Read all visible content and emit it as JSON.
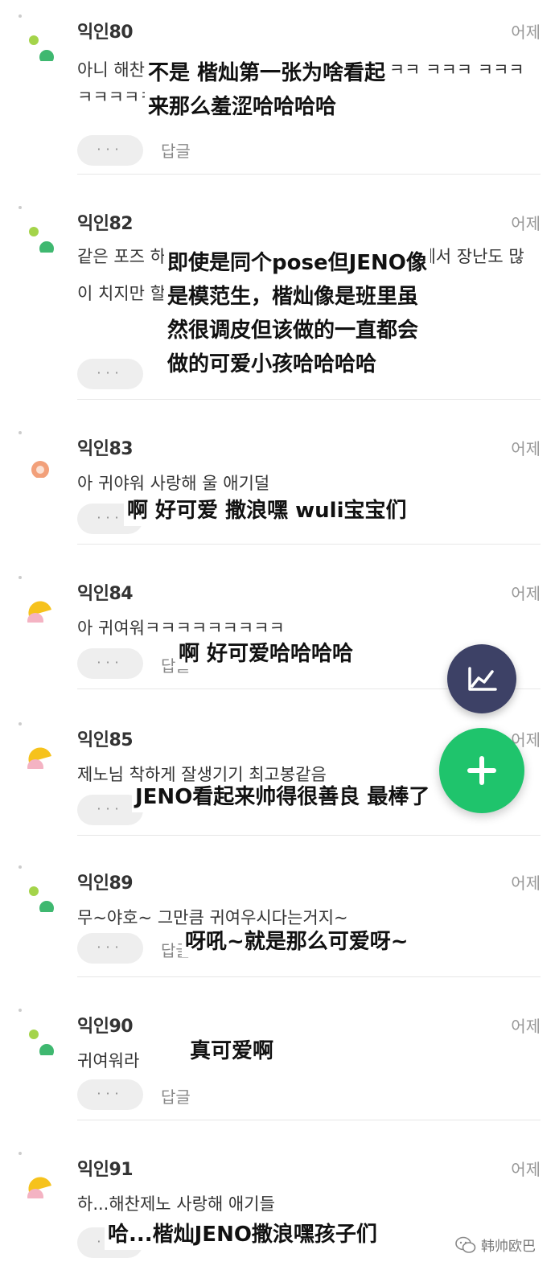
{
  "comments": [
    {
      "name": "익인80",
      "time": "어제",
      "body": "아니 해찬이 떡대 왜 이렇게 귀엽냐고 보이직ㅋㅋ ㅋㅋㅋ ㅋㅋㅋㅋㅋㅋㅋㅋ",
      "more": "···",
      "reply": "답글",
      "overlay": [
        "不是 楷灿第一张为啥看起",
        "来那么羞涩哈哈哈哈"
      ],
      "avatar": "green-dots"
    },
    {
      "name": "익인82",
      "time": "어제",
      "body": "같은 포즈 하는데 제노는 모범생이고 해찬이는 반에서 장난도 많이 치지만 할 건 다 하는 귀여운 애같음 ㅋㅋㅋㅋ",
      "more": "···",
      "reply": "답글",
      "overlay": [
        "即使是同个pose但JENO像",
        "是模范生，楷灿像是班里虽",
        "然很调皮但该做的一直都会",
        "做的可爱小孩哈哈哈哈"
      ],
      "avatar": "green-dots"
    },
    {
      "name": "익인83",
      "time": "어제",
      "body": "아 귀야워 사랑해 울 애기덜",
      "more": "···",
      "reply": "답글",
      "overlay": [
        "啊 好可爱 撒浪嘿 wuli宝宝们"
      ],
      "avatar": "orange-ring"
    },
    {
      "name": "익인84",
      "time": "어제",
      "body": "아 귀여워ㅋㅋㅋㅋㅋㅋㅋㅋㅋ",
      "more": "···",
      "reply": "답글",
      "overlay": [
        "啊 好可爱哈哈哈哈"
      ],
      "avatar": "yellow-pink"
    },
    {
      "name": "익인85",
      "time": "어제",
      "body": "제노님 착하게 잘생기기 최고봉같음",
      "more": "···",
      "reply": "답글",
      "overlay": [
        "JENO看起来帅得很善良 最棒了"
      ],
      "avatar": "yellow-pink"
    },
    {
      "name": "익인89",
      "time": "어제",
      "body": "무~야호~ 그만큼 귀여우시다는거지~",
      "more": "···",
      "reply": "답글",
      "overlay": [
        "呀吼~就是那么可爱呀~"
      ],
      "avatar": "green-dots"
    },
    {
      "name": "익인90",
      "time": "어제",
      "body": "귀여워라",
      "more": "···",
      "reply": "답글",
      "overlay": [
        "真可爱啊"
      ],
      "avatar": "green-dots"
    },
    {
      "name": "익인91",
      "time": "어제",
      "body": "하...해찬제노 사랑해 애기들",
      "more": "···",
      "reply": "답글",
      "overlay": [
        "哈...楷灿JENO撒浪嘿孩子们"
      ],
      "avatar": "yellow-pink"
    }
  ],
  "fab": {
    "trend_icon": "trend-chart-icon",
    "add_icon": "plus-icon"
  },
  "watermark": {
    "text": "韩帅欧巴",
    "icon": "wechat-icon"
  },
  "colors": {
    "fab_dark": "#3d4166",
    "fab_green": "#1fc46c",
    "dot_green": "#3fb870",
    "dot_lime": "#a4d44a",
    "avatar_orange": "#f2a07a",
    "avatar_yellow": "#f6c21c",
    "avatar_pink": "#f4b3c3"
  }
}
